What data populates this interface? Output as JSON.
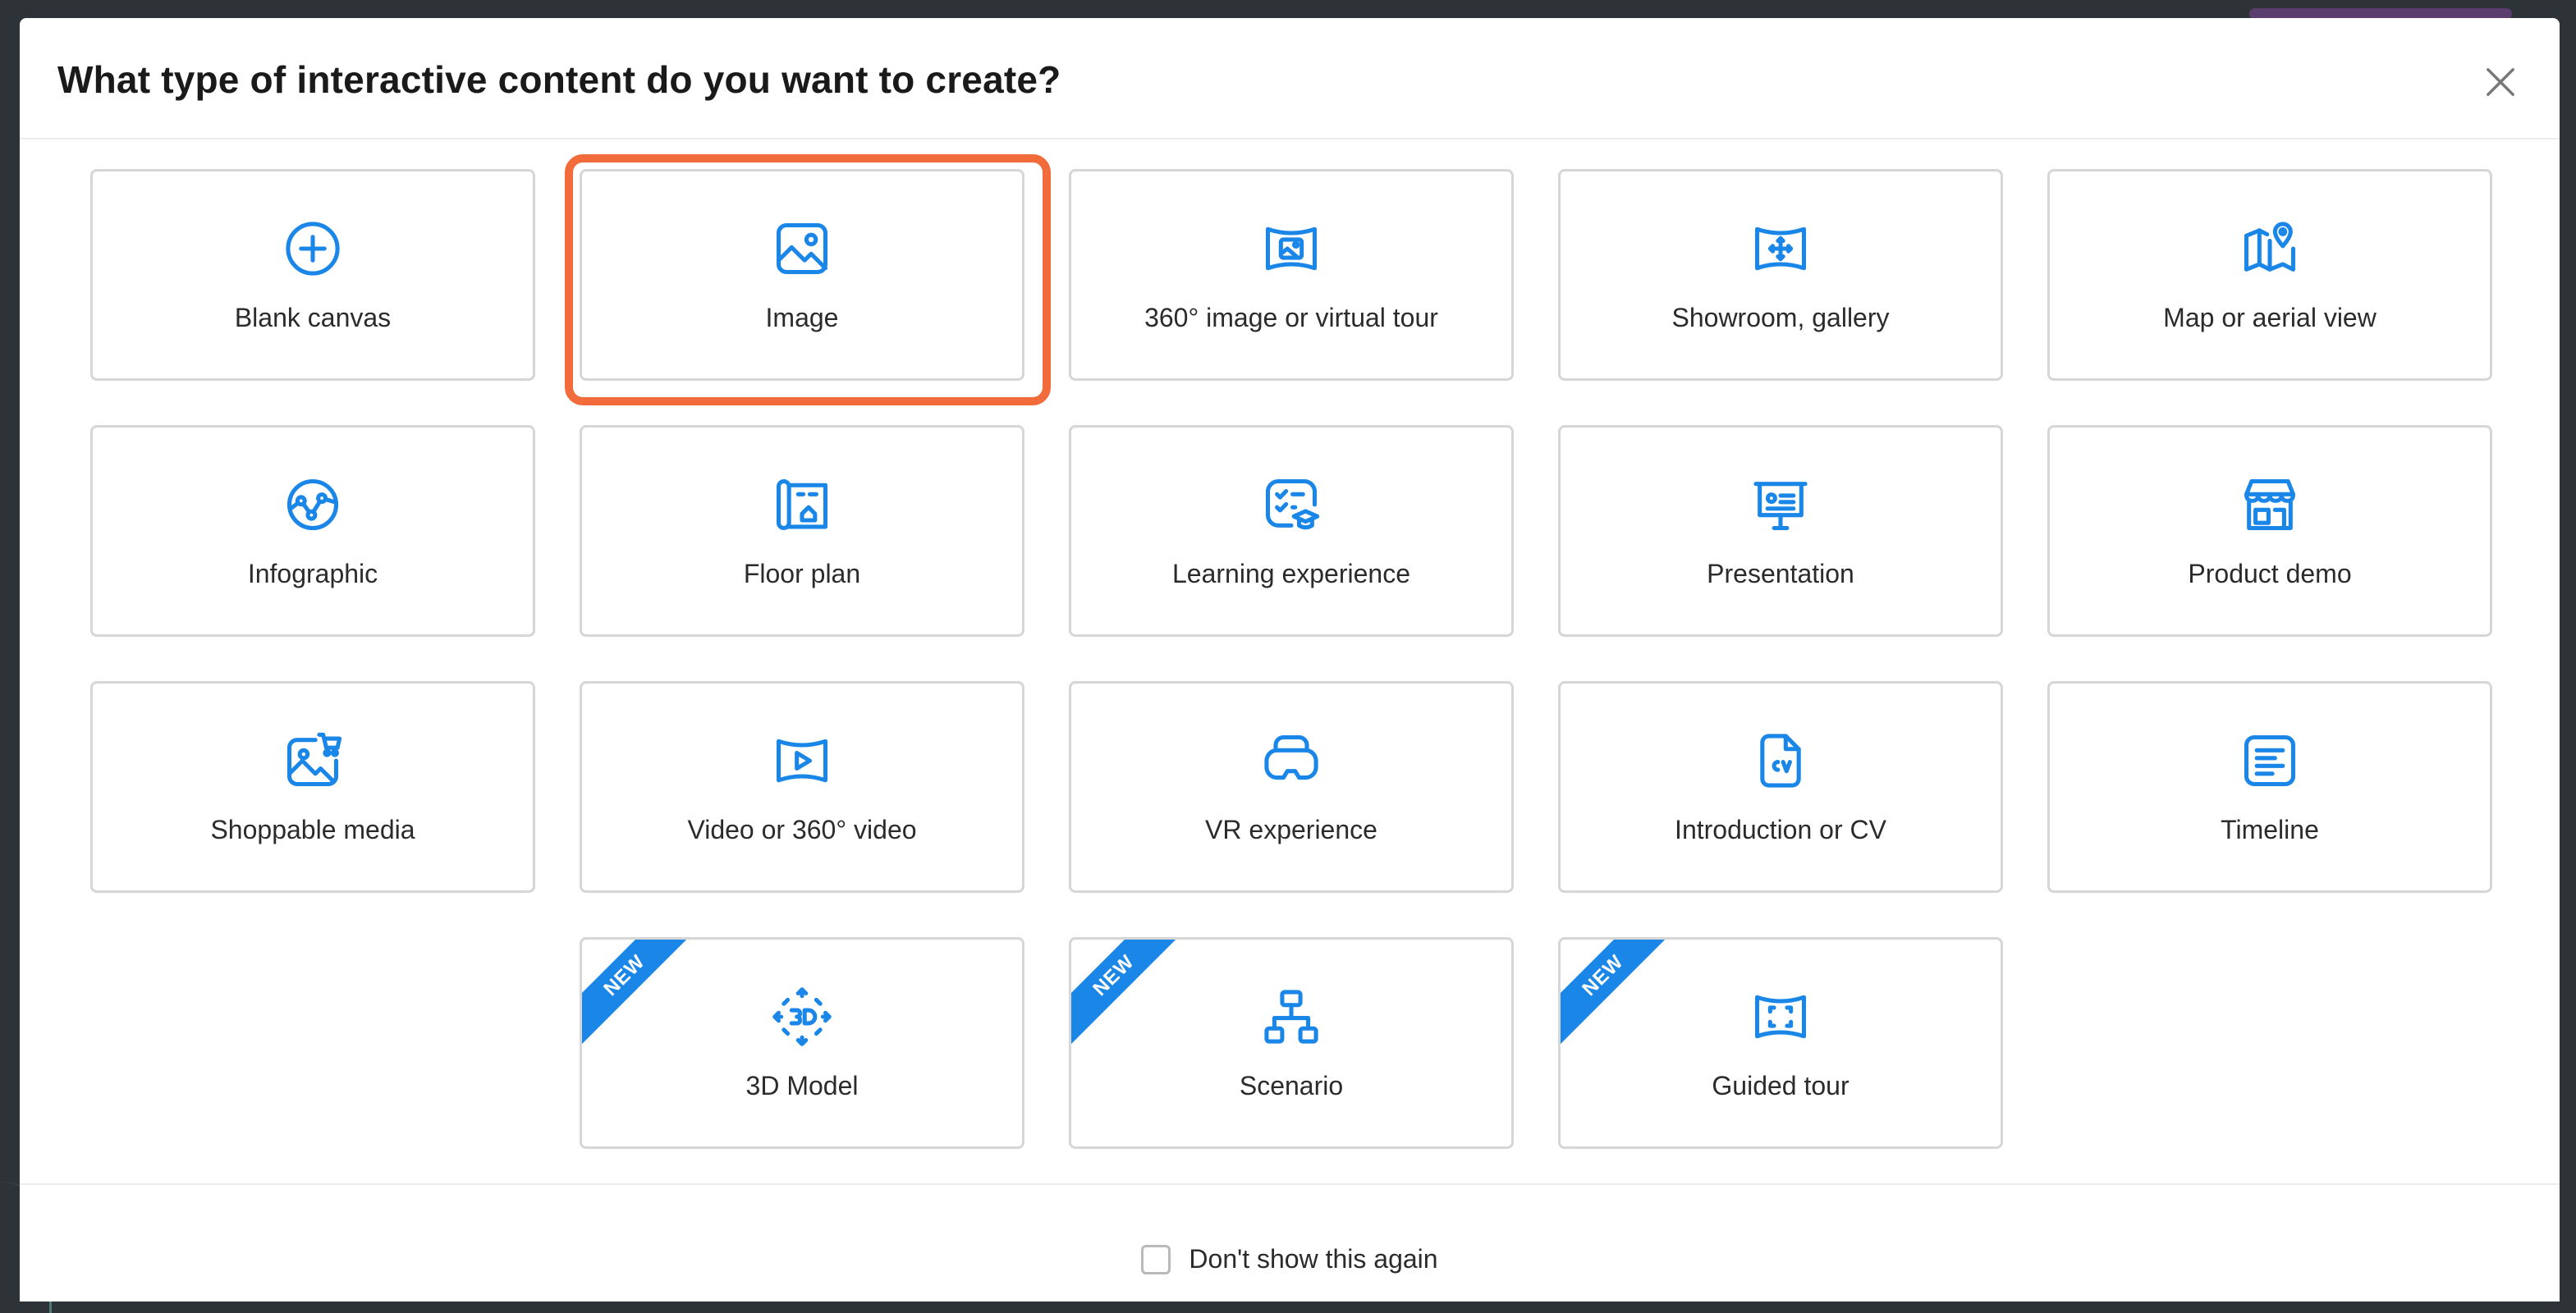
{
  "dialog": {
    "title": "What type of interactive content do you want to create?",
    "close_icon": "close-icon"
  },
  "cards": [
    {
      "label": "Blank canvas",
      "icon": "plus-circle-icon"
    },
    {
      "label": "Image",
      "icon": "image-icon",
      "highlighted": true
    },
    {
      "label": "360° image or virtual tour",
      "icon": "panorama-image-icon"
    },
    {
      "label": "Showroom, gallery",
      "icon": "showroom-move-icon"
    },
    {
      "label": "Map or aerial view",
      "icon": "map-pin-icon"
    },
    {
      "label": "Infographic",
      "icon": "infographic-icon"
    },
    {
      "label": "Floor plan",
      "icon": "floor-plan-icon"
    },
    {
      "label": "Learning experience",
      "icon": "learning-checklist-icon"
    },
    {
      "label": "Presentation",
      "icon": "presentation-board-icon"
    },
    {
      "label": "Product demo",
      "icon": "storefront-icon"
    },
    {
      "label": "Shoppable media",
      "icon": "image-cart-icon"
    },
    {
      "label": "Video or 360° video",
      "icon": "panorama-play-icon"
    },
    {
      "label": "VR experience",
      "icon": "vr-headset-icon"
    },
    {
      "label": "Introduction or CV",
      "icon": "cv-document-icon"
    },
    {
      "label": "Timeline",
      "icon": "text-lines-icon"
    },
    {
      "label": "3D Model",
      "icon": "3d-cube-icon",
      "badge": "NEW"
    },
    {
      "label": "Scenario",
      "icon": "hierarchy-icon",
      "badge": "NEW"
    },
    {
      "label": "Guided tour",
      "icon": "panorama-frame-icon",
      "badge": "NEW"
    }
  ],
  "footer": {
    "checkbox_label": "Don't show this again",
    "checked": false
  },
  "colors": {
    "accent": "#1A86E8",
    "highlight": "#F26B3A",
    "card_border": "#D6D6D6",
    "text": "#2B2B2B"
  }
}
